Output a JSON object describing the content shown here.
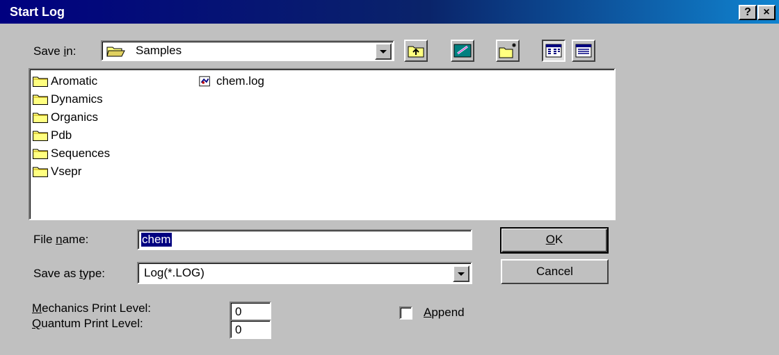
{
  "window": {
    "title": "Start Log",
    "help": "?",
    "close": "×"
  },
  "save_in": {
    "label_pre": "Save ",
    "label_key": "i",
    "label_post": "n:",
    "value": "Samples"
  },
  "toolbar": {
    "icons": [
      "up-one-level-icon",
      "desktop-icon",
      "new-folder-icon",
      "list-view-icon",
      "details-view-icon"
    ]
  },
  "files": {
    "folders": [
      "Aromatic",
      "Dynamics",
      "Organics",
      "Pdb",
      "Sequences",
      "Vsepr"
    ],
    "docs": [
      "chem.log"
    ]
  },
  "filename": {
    "label_pre": "File ",
    "label_key": "n",
    "label_post": "ame:",
    "value": "chem"
  },
  "save_type": {
    "label_pre": "Save as ",
    "label_key": "t",
    "label_post": "ype:",
    "value": "Log(*.LOG)"
  },
  "buttons": {
    "ok_key": "O",
    "ok_rest": "K",
    "cancel": "Cancel"
  },
  "mechanics": {
    "label_key": "M",
    "label_rest": "echanics Print Level:",
    "value": "0"
  },
  "quantum": {
    "label_key": "Q",
    "label_rest": "uantum Print Level:",
    "value": "0"
  },
  "append": {
    "label_key": "A",
    "label_rest": "ppend",
    "checked": false
  }
}
